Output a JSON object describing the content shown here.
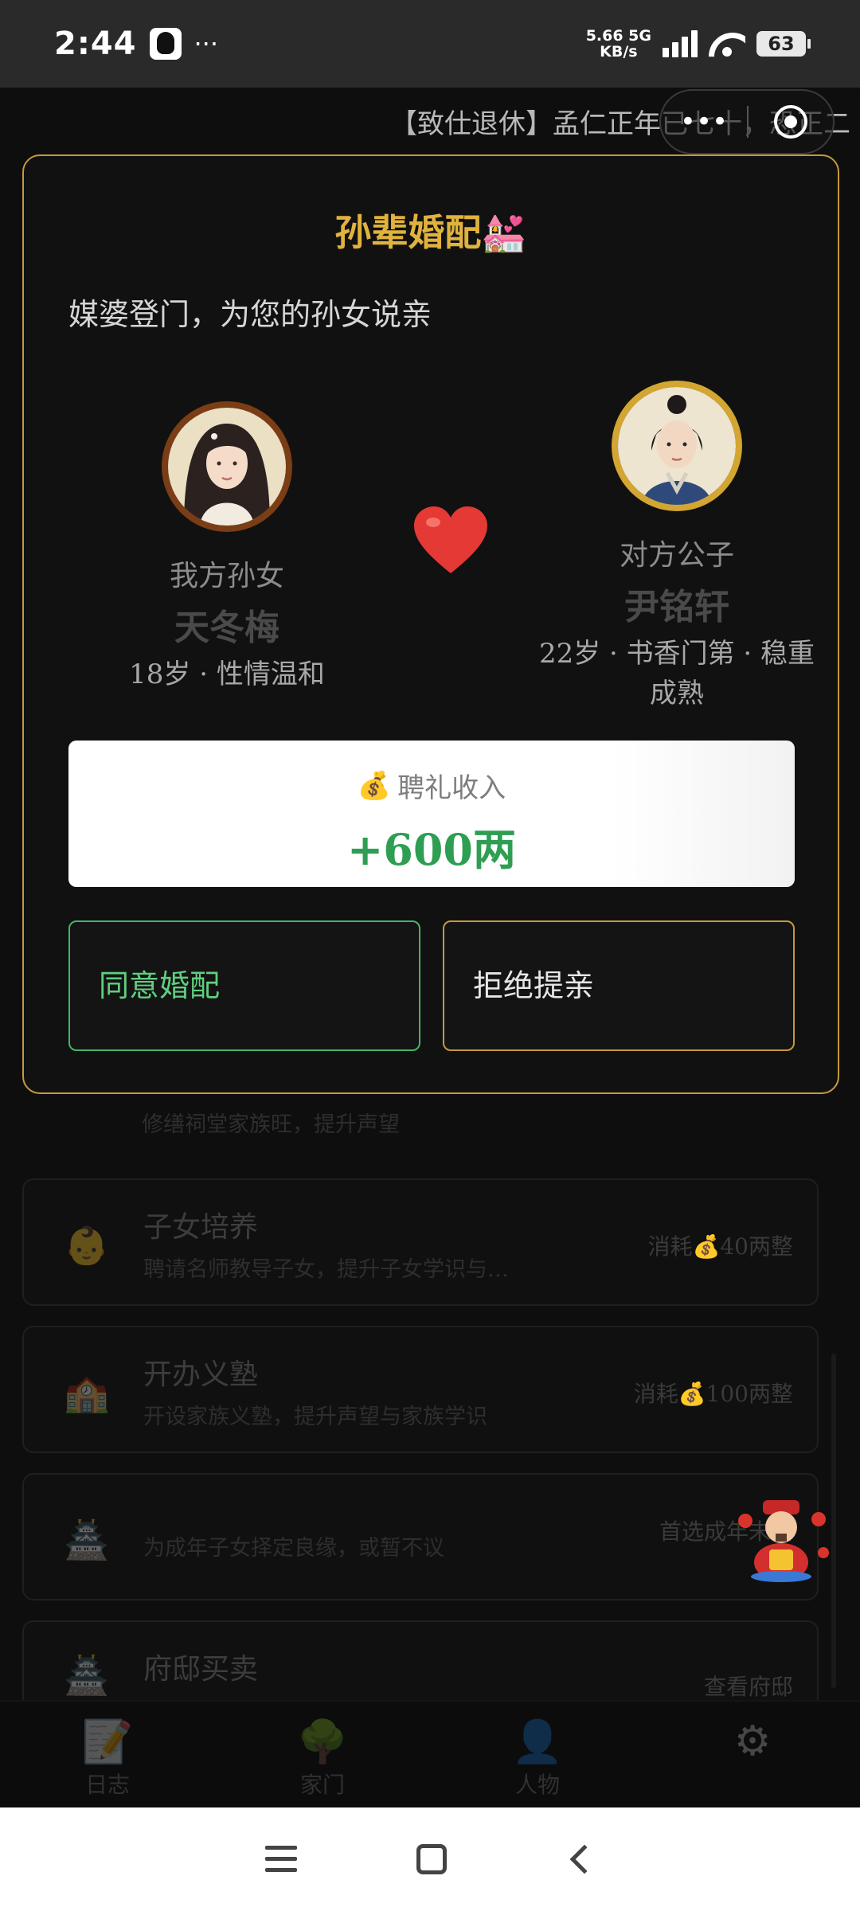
{
  "status_bar": {
    "time": "2:44",
    "dots": "···",
    "net_speed_value": "5.66 5G",
    "net_speed_unit": "KB/s",
    "battery": "63"
  },
  "background": {
    "ticker": "【致仕退休】孟仁正年已七十，恐正二",
    "capsule_menu": "•••",
    "partial_desc": "修缮祠堂家族旺，提升声望",
    "cards": [
      {
        "icon": "👶",
        "title": "子女培养",
        "desc": "聘请名师教导子女，提升子女学识与…",
        "cost": "消耗💰40两整"
      },
      {
        "icon": "🏫",
        "title": "开办义塾",
        "desc": "开设家族义塾，提升声望与家族学识",
        "cost": "消耗💰100两整"
      },
      {
        "icon": "🏯",
        "title": "",
        "desc": "为成年子女择定良缘，或暂不议",
        "cost": "首选成年未婚"
      },
      {
        "icon": "🏯",
        "title": "府邸买卖",
        "desc": "",
        "cost": "查看府邸"
      }
    ],
    "nav": [
      {
        "icon": "📝",
        "label": "日志"
      },
      {
        "icon": "🌳",
        "label": "家门"
      },
      {
        "icon": "👤",
        "label": "人物"
      },
      {
        "icon": "⚙",
        "label": ""
      }
    ]
  },
  "modal": {
    "title": "孙辈婚配💒",
    "subtitle": "媒婆登门，为您的孙女说亲",
    "bride": {
      "role": "我方孙女",
      "name": "天冬梅",
      "info": "18岁 · 性情温和"
    },
    "groom": {
      "role": "对方公子",
      "name": "尹铭轩",
      "info_line1": "22岁 · 书香门第 · 稳重",
      "info_line2": "成熟"
    },
    "gift_label": "聘礼收入",
    "gift_amount": "+600两",
    "agree_button": "同意婚配",
    "reject_button": "拒绝提亲"
  },
  "colors": {
    "accent_gold": "#c59a3b",
    "title_gold": "#e0b23e",
    "agree_green": "#43b566",
    "amount_green": "#2e9e52"
  }
}
